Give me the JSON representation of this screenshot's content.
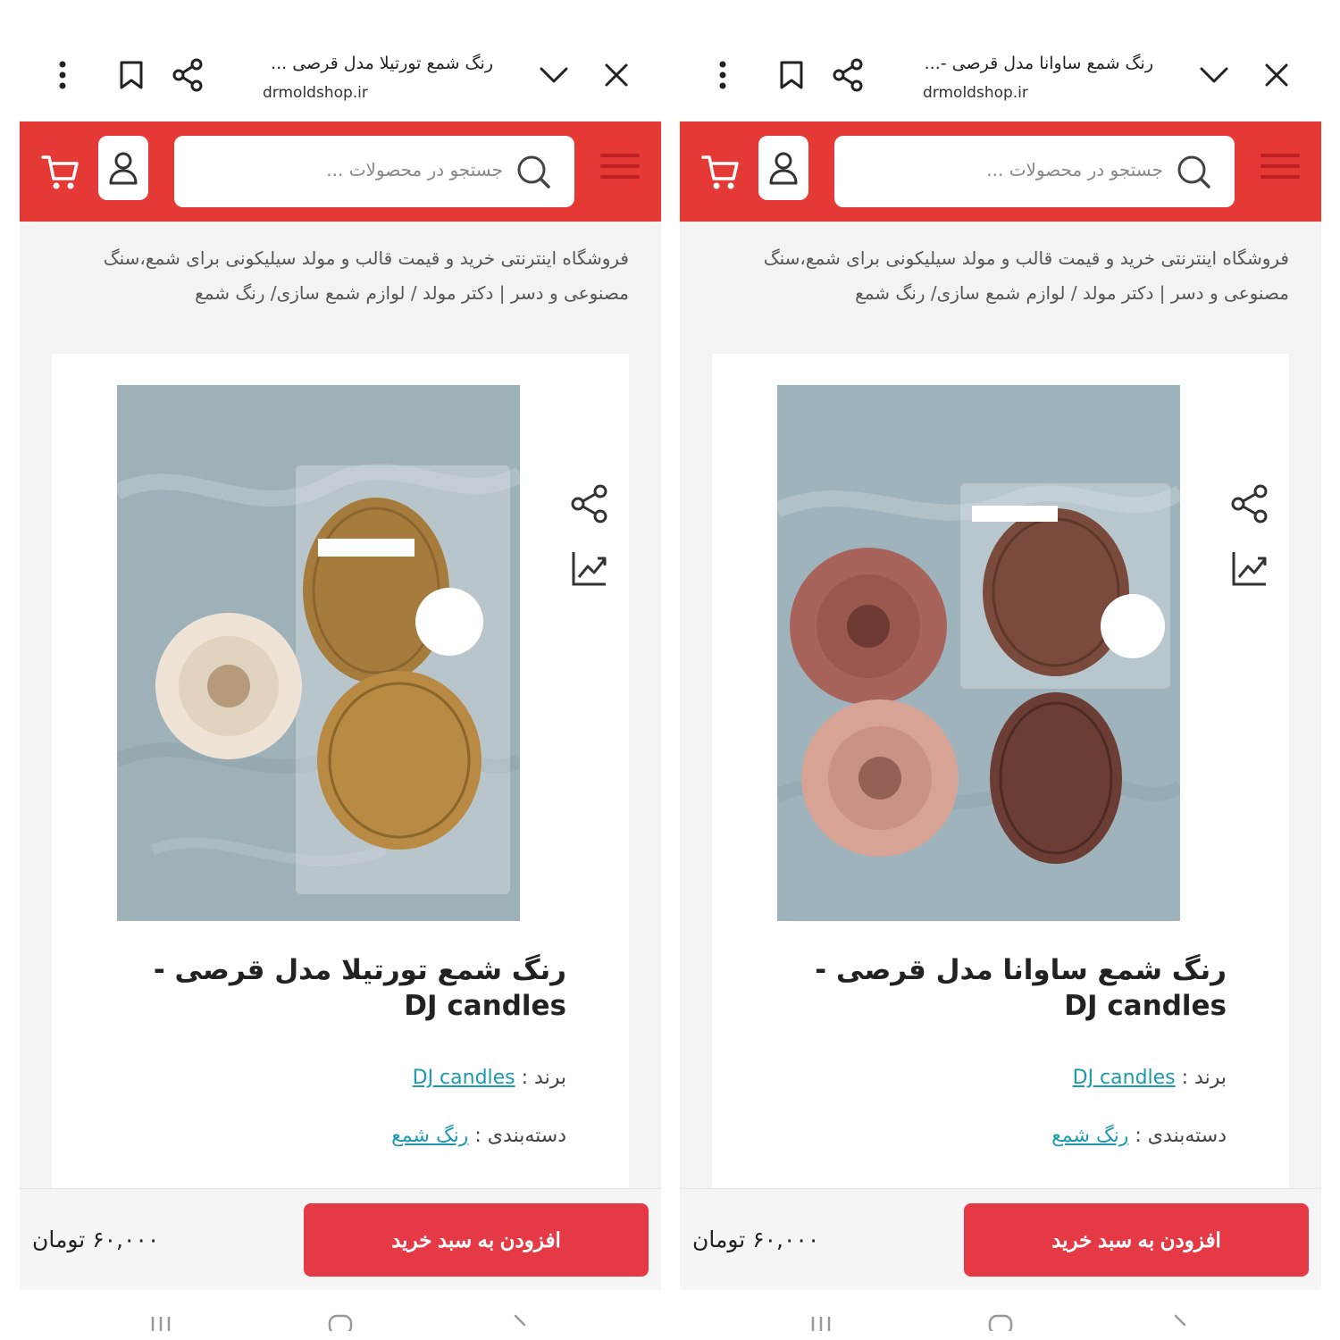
{
  "screens": [
    {
      "browser": {
        "tab_title": "رنگ شمع تورتیلا مدل قرصی ...",
        "url": "drmoldshop.ir"
      },
      "site": {
        "search_placeholder": "جستجو در محصولات ..."
      },
      "breadcrumb": "فروشگاه اینترنتی خرید و قیمت قالب و مولد سیلیکونی برای شمع،سنگ مصنوعی و دسر | دکتر مولد / لوازم شمع سازی/ رنگ شمع",
      "product": {
        "title": "رنگ شمع تورتیلا مدل قرصی - DJ candles",
        "brand_label": "برند :",
        "brand_value": "DJ candles",
        "category_label": "دسته‌بندی :",
        "category_value": "رنگ شمع",
        "image_variant": "tortila"
      },
      "buy_bar": {
        "add_to_cart": "افزودن به سبد خرید",
        "price": "۶۰,۰۰۰ تومان"
      }
    },
    {
      "browser": {
        "tab_title": "رنگ شمع ساوانا مدل قرصی -...",
        "url": "drmoldshop.ir"
      },
      "site": {
        "search_placeholder": "جستجو در محصولات ..."
      },
      "breadcrumb": "فروشگاه اینترنتی خرید و قیمت قالب و مولد سیلیکونی برای شمع،سنگ مصنوعی و دسر | دکتر مولد / لوازم شمع سازی/ رنگ شمع",
      "product": {
        "title": "رنگ شمع ساوانا مدل قرصی - DJ candles",
        "brand_label": "برند :",
        "brand_value": "DJ candles",
        "category_label": "دسته‌بندی :",
        "category_value": "رنگ شمع",
        "image_variant": "savana"
      },
      "buy_bar": {
        "add_to_cart": "افزودن به سبد خرید",
        "price": "۶۰,۰۰۰ تومان"
      }
    }
  ],
  "colors": {
    "brand_red": "#e53935",
    "button_red": "#e53946",
    "link_teal": "#1e9ab0",
    "page_bg": "#f3f3f3"
  },
  "icons": [
    "close-icon",
    "chevron-down-icon",
    "share-icon",
    "bookmark-icon",
    "more-vert-icon",
    "hamburger-icon",
    "search-icon",
    "user-icon",
    "cart-icon",
    "chart-icon"
  ]
}
